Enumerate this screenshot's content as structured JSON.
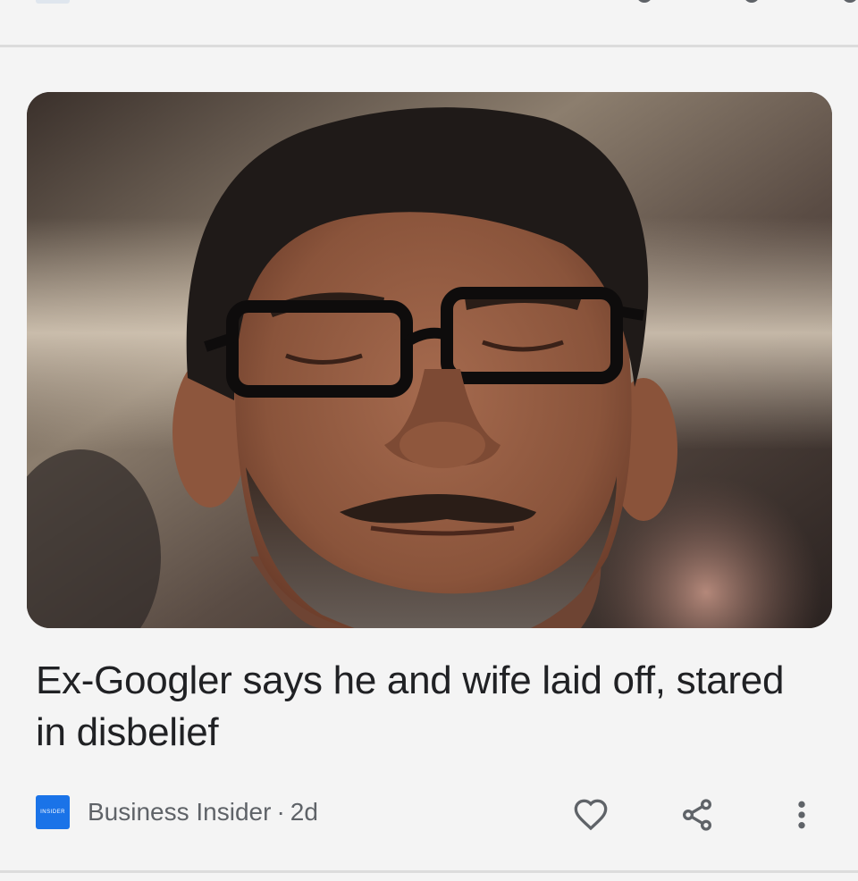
{
  "article": {
    "headline": "Ex-Googler says he and wife laid off, stared in disbelief",
    "source": {
      "name": "Business Insider",
      "logo_text": "INSIDER",
      "separator": "·",
      "age": "2d",
      "brand_color": "#1a73e8"
    },
    "image": {
      "icon": "news-photo"
    },
    "actions": [
      {
        "name": "like",
        "icon": "heart-icon"
      },
      {
        "name": "share",
        "icon": "share-icon"
      },
      {
        "name": "more",
        "icon": "more-vert-icon"
      }
    ]
  },
  "colors": {
    "background": "#f4f4f4",
    "divider": "#dcdcdc",
    "headline": "#202124",
    "meta": "#5f6368"
  }
}
